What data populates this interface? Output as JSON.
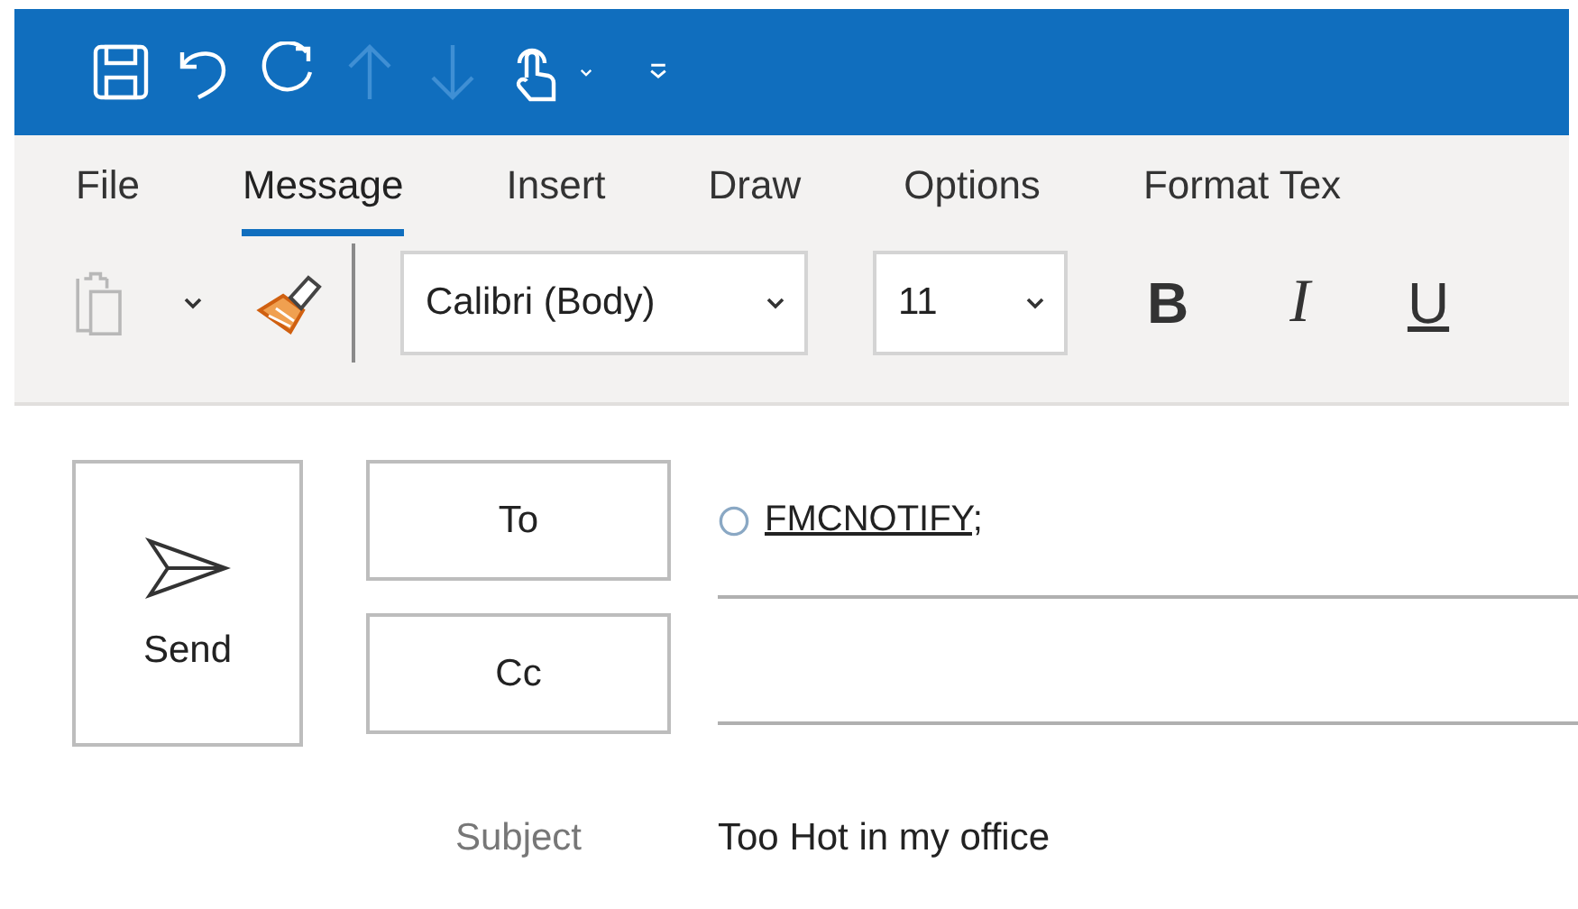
{
  "quick_access": [
    {
      "kind": "save",
      "disabled": false
    },
    {
      "kind": "undo",
      "disabled": false
    },
    {
      "kind": "redo",
      "disabled": false
    },
    {
      "kind": "up",
      "disabled": true
    },
    {
      "kind": "down",
      "disabled": true
    },
    {
      "kind": "touch",
      "disabled": false
    },
    {
      "kind": "chevron",
      "disabled": false
    },
    {
      "kind": "customize",
      "disabled": false
    }
  ],
  "tabs": [
    {
      "label": "File",
      "selected": false
    },
    {
      "label": "Message",
      "selected": true
    },
    {
      "label": "Insert",
      "selected": false
    },
    {
      "label": "Draw",
      "selected": false
    },
    {
      "label": "Options",
      "selected": false
    },
    {
      "label": "Format Tex",
      "selected": false
    }
  ],
  "toolbar": {
    "paste_disabled": true,
    "font": "Calibri (Body)",
    "size": "11",
    "bold": "B",
    "italic": "I",
    "underline": "U"
  },
  "compose": {
    "send": "Send",
    "to_button": "To",
    "cc_button": "Cc",
    "recipients": [
      "FMCNOTIFY;"
    ],
    "subject_label": "Subject",
    "subject": "Too Hot in my office"
  }
}
